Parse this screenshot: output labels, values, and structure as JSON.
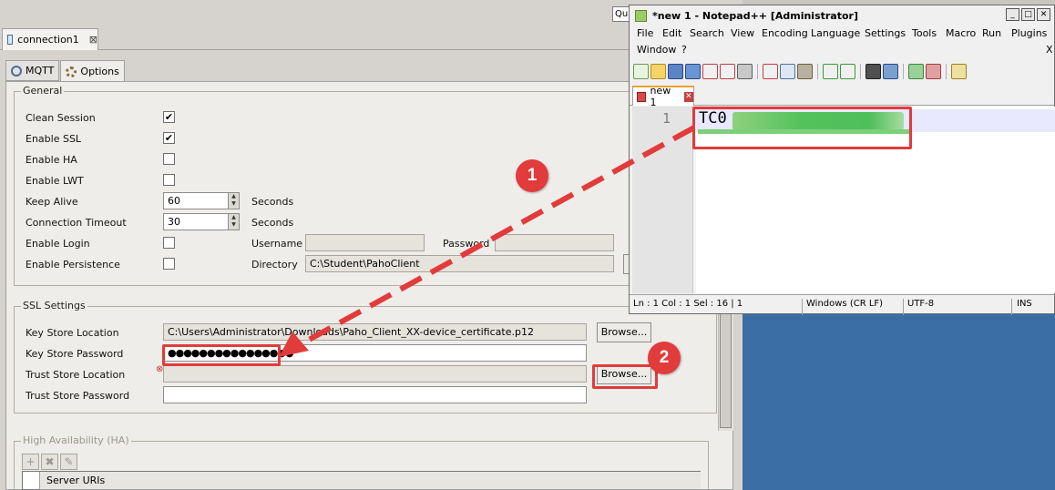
{
  "paho": {
    "quick_access": "Qu",
    "connection_tab": {
      "label": "connection1",
      "close": "⊠"
    },
    "subtabs": [
      {
        "label": "MQTT"
      },
      {
        "label": "Options"
      }
    ],
    "general": {
      "title": "General",
      "clean_session": {
        "label": "Clean Session",
        "checked": "✔"
      },
      "enable_ssl": {
        "label": "Enable SSL",
        "checked": "✔"
      },
      "enable_ha": {
        "label": "Enable HA"
      },
      "enable_lwt": {
        "label": "Enable LWT"
      },
      "keep_alive": {
        "label": "Keep Alive",
        "value": "60",
        "unit": "Seconds"
      },
      "connection_timeout": {
        "label": "Connection Timeout",
        "value": "30",
        "unit": "Seconds"
      },
      "enable_login": {
        "label": "Enable Login"
      },
      "username_label": "Username",
      "password_label": "Password",
      "enable_persistence": {
        "label": "Enable Persistence"
      },
      "directory": {
        "label": "Directory",
        "value": "C:\\Student\\PahoClient"
      }
    },
    "ssl": {
      "title": "SSL Settings",
      "key_store_location": {
        "label": "Key Store Location",
        "value": "C:\\Users\\Administrator\\Downloads\\Paho_Client_XX-device_certificate.p12"
      },
      "key_store_password": {
        "label": "Key Store Password",
        "value": "●●●●●●●●●●●●●●●●"
      },
      "trust_store_location": {
        "label": "Trust Store Location",
        "value": ""
      },
      "trust_store_password": {
        "label": "Trust Store Password",
        "value": ""
      },
      "browse_label": "Browse...",
      "error_glyph": "⊗"
    },
    "ha": {
      "title": "High Availability (HA)",
      "tools": [
        "+",
        "✖",
        "✎"
      ],
      "column": "Server URIs"
    }
  },
  "annotations": {
    "step1": "1",
    "step2": "2",
    "color": "#e23b3b"
  },
  "notepad": {
    "title": "*new 1 - Notepad++ [Administrator]",
    "window_buttons": [
      "_",
      "□",
      "✕"
    ],
    "menu": [
      "File",
      "Edit",
      "Search",
      "View",
      "Encoding",
      "Language",
      "Settings",
      "Tools",
      "Macro",
      "Run",
      "Plugins",
      "Window",
      "?"
    ],
    "menu_close": "X",
    "tab": {
      "label": "new 1",
      "close": "✕"
    },
    "editor": {
      "line_number": "1",
      "text": "TC0"
    },
    "status": {
      "ln_col": "Ln : 1    Col : 1    Sel : 16 | 1",
      "eol": "Windows (CR LF)",
      "encoding": "UTF-8",
      "mode": "INS"
    }
  }
}
